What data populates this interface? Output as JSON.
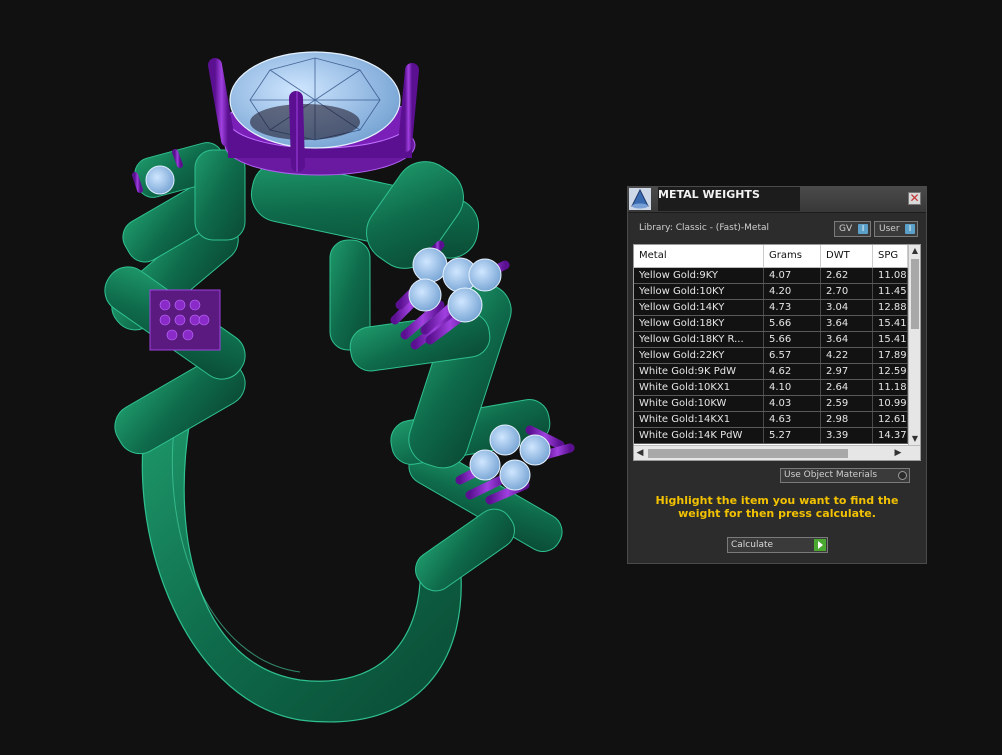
{
  "panel": {
    "title": "METAL WEIGHTS",
    "close_glyph": "✕",
    "library_label": "Library: Classic - (Fast)-Metal",
    "toggle_gv": "GV",
    "toggle_user": "User",
    "toggle_knob": "I",
    "columns": [
      "Metal",
      "Grams",
      "DWT",
      "SPG"
    ],
    "rows": [
      [
        "Yellow Gold:9KY",
        "4.07",
        "2.62",
        "11.08"
      ],
      [
        "Yellow Gold:10KY",
        "4.20",
        "2.70",
        "11.45"
      ],
      [
        "Yellow Gold:14KY",
        "4.73",
        "3.04",
        "12.88"
      ],
      [
        "Yellow Gold:18KY",
        "5.66",
        "3.64",
        "15.41"
      ],
      [
        "Yellow Gold:18KY R...",
        "5.66",
        "3.64",
        "15.41"
      ],
      [
        "Yellow Gold:22KY",
        "6.57",
        "4.22",
        "17.89"
      ],
      [
        "White Gold:9K PdW",
        "4.62",
        "2.97",
        "12.59"
      ],
      [
        "White Gold:10KX1",
        "4.10",
        "2.64",
        "11.18"
      ],
      [
        "White Gold:10KW",
        "4.03",
        "2.59",
        "10.99"
      ],
      [
        "White Gold:14KX1",
        "4.63",
        "2.98",
        "12.61"
      ],
      [
        "White Gold:14K PdW",
        "5.27",
        "3.39",
        "14.37"
      ]
    ],
    "use_object_materials": "Use Object Materials",
    "instruction": "Highlight the item you want to find the weight for then press calculate.",
    "calculate_label": "Calculate"
  },
  "colors": {
    "background": "#111111",
    "ring_metal": "#0f6e4e",
    "prongs": "#7a1fb0",
    "stones": "#9ac8f0",
    "instruction_text": "#f2c200"
  }
}
